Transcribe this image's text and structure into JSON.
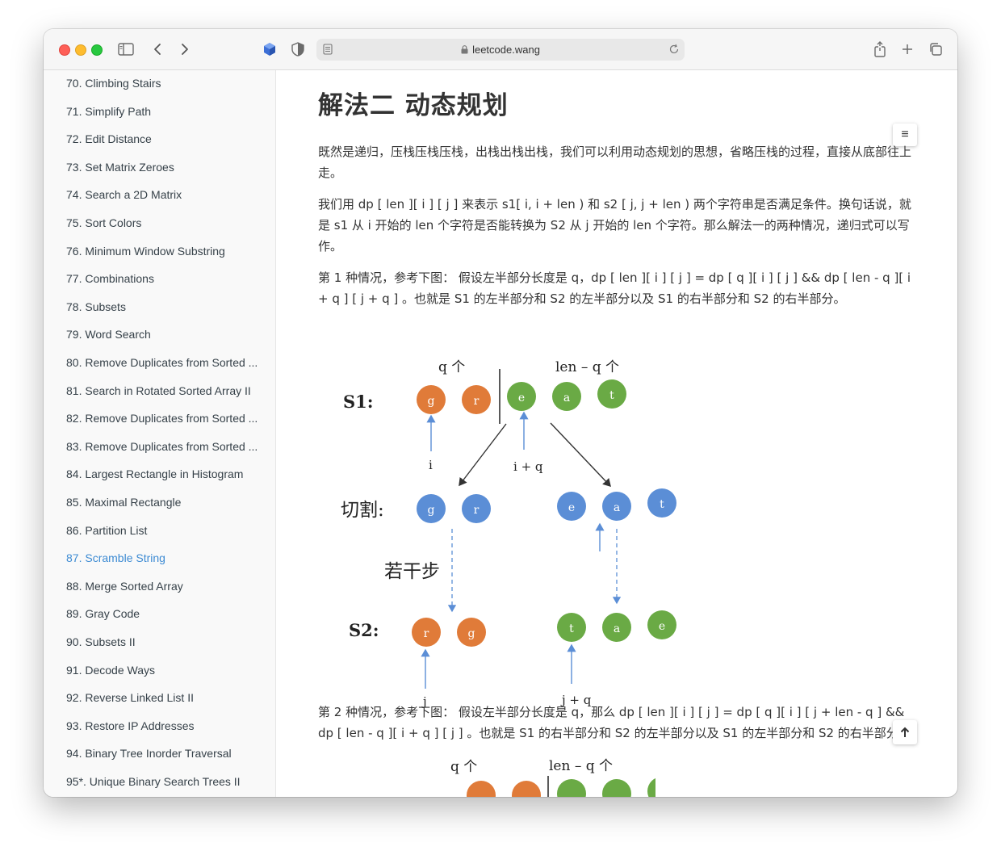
{
  "browser": {
    "url": "leetcode.wang"
  },
  "sidebar": {
    "items": [
      {
        "label": "70. Climbing Stairs",
        "active": false
      },
      {
        "label": "71. Simplify Path",
        "active": false
      },
      {
        "label": "72. Edit Distance",
        "active": false
      },
      {
        "label": "73. Set Matrix Zeroes",
        "active": false
      },
      {
        "label": "74. Search a 2D Matrix",
        "active": false
      },
      {
        "label": "75. Sort Colors",
        "active": false
      },
      {
        "label": "76. Minimum Window Substring",
        "active": false
      },
      {
        "label": "77. Combinations",
        "active": false
      },
      {
        "label": "78. Subsets",
        "active": false
      },
      {
        "label": "79. Word Search",
        "active": false
      },
      {
        "label": "80. Remove Duplicates from Sorted ...",
        "active": false
      },
      {
        "label": "81. Search in Rotated Sorted Array II",
        "active": false
      },
      {
        "label": "82. Remove Duplicates from Sorted ...",
        "active": false
      },
      {
        "label": "83. Remove Duplicates from Sorted ...",
        "active": false
      },
      {
        "label": "84. Largest Rectangle in Histogram",
        "active": false
      },
      {
        "label": "85. Maximal Rectangle",
        "active": false
      },
      {
        "label": "86. Partition List",
        "active": false
      },
      {
        "label": "87. Scramble String",
        "active": true
      },
      {
        "label": "88. Merge Sorted Array",
        "active": false
      },
      {
        "label": "89. Gray Code",
        "active": false
      },
      {
        "label": "90. Subsets II",
        "active": false
      },
      {
        "label": "91. Decode Ways",
        "active": false
      },
      {
        "label": "92. Reverse Linked List II",
        "active": false
      },
      {
        "label": "93. Restore IP Addresses",
        "active": false
      },
      {
        "label": "94. Binary Tree Inorder Traversal",
        "active": false
      },
      {
        "label": "95*. Unique Binary Search Trees II",
        "active": false
      }
    ]
  },
  "article": {
    "heading": "解法二 动态规划",
    "paragraphs": [
      "既然是递归，压栈压栈压栈，出栈出栈出栈，我们可以利用动态规划的思想，省略压栈的过程，直接从底部往上走。",
      "我们用 dp [ len ][ i ] [ j ] 来表示 s1[ i, i + len ) 和 s2 [ j, j + len ) 两个字符串是否满足条件。换句话说，就是 s1 从 i 开始的 len 个字符是否能转换为 S2 从 j 开始的 len 个字符。那么解法一的两种情况，递归式可以写作。",
      "第 1 种情况，参考下图： 假设左半部分长度是 q，dp [ len ][ i ] [ j ] = dp [ q ][ i ] [ j ] && dp [ len - q ][ i + q ] [ j + q ] 。也就是 S1 的左半部分和 S2 的左半部分以及 S1 的右半部分和 S2 的右半部分。",
      "第 2 种情况，参考下图： 假设左半部分长度是 q，那么 dp [ len ][ i ] [ j ] = dp [ q ][ i ] [ j + len - q ] && dp [ len - q ][ i + q ] [ j ] 。也就是 S1 的右半部分和 S2 的左半部分以及 S1 的左半部分和 S2 的右半部分。"
    ],
    "toc_icon": "list-icon",
    "back_to_top_icon": "arrow-up-icon"
  },
  "diagram1": {
    "label_s1": "S1:",
    "label_cut": "切割:",
    "label_steps": "若干步",
    "label_s2": "S2:",
    "label_q": "q 个",
    "label_lenq": "len – q 个",
    "label_i": "i",
    "label_iq": "i + q",
    "label_j": "j",
    "label_jq": "j + q",
    "s1_nodes": [
      "g",
      "r",
      "e",
      "a",
      "t"
    ],
    "cut_nodes": [
      "g",
      "r",
      "e",
      "a",
      "t"
    ],
    "s2_nodes": [
      "r",
      "g",
      "t",
      "a",
      "e"
    ],
    "colors": {
      "orange": "#e07b39",
      "green": "#6aaa45",
      "blue": "#5b8ed6"
    }
  },
  "diagram2": {
    "label_q": "q 个",
    "label_lenq": "len – q 个"
  }
}
